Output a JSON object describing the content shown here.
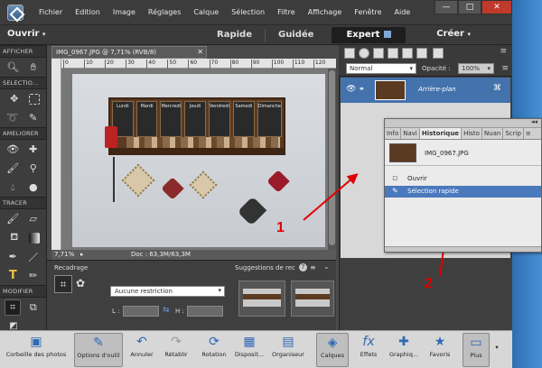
{
  "menubar": {
    "items": [
      "Fichier",
      "Edition",
      "Image",
      "Réglages",
      "Calque",
      "Sélection",
      "Filtre",
      "Affichage",
      "Fenêtre",
      "Aide"
    ],
    "minimize": "—",
    "maximize": "□",
    "close": "✕"
  },
  "modebar": {
    "open_label": "Ouvrir",
    "modes": [
      "Rapide",
      "Guidée",
      "Expert"
    ],
    "active_mode": "Expert",
    "create_label": "Créer"
  },
  "toolbox": {
    "sections": [
      "AFFICHER",
      "SELECTIO...",
      "AMELIORER",
      "TRACER",
      "MODIFIER"
    ]
  },
  "document": {
    "tab_title": "IMG_0967.JPG @ 7,71% (RVB/8)",
    "close": "✕",
    "zoom": "7,71%",
    "doc_info": "Doc : 63,3M/63,3M",
    "ruler_ticks": [
      "0",
      "10",
      "20",
      "30",
      "40",
      "50",
      "60",
      "70",
      "80",
      "90",
      "100",
      "110",
      "120"
    ],
    "photo_labels": [
      "Lundi",
      "Mardi",
      "Mercredi",
      "Jeudi",
      "Vendredi",
      "Samedi",
      "Dimanche"
    ]
  },
  "tool_options": {
    "tool_title": "Recadrage",
    "restriction": "Aucune restriction",
    "l_label": "L :",
    "h_label": "H :",
    "suggestions_label": "Suggestions de rec"
  },
  "layers": {
    "blend_mode": "Normal",
    "opacity_label": "Opacité :",
    "opacity_value": "100%",
    "layer_name": "Arrière-plan"
  },
  "history": {
    "tabs": [
      "Info",
      "Navi",
      "Historique",
      "Histo",
      "Nuan",
      "Scrip"
    ],
    "active_tab": "Historique",
    "snapshot_name": "IMG_0967.JPG",
    "items": [
      "Ouvrir",
      "Sélection rapide"
    ],
    "selected_item": "Sélection rapide"
  },
  "taskbar": {
    "buttons": [
      "Corbeille des photos",
      "Options d'outil",
      "Annuler",
      "Rétablir",
      "Rotation",
      "Disposit...",
      "Organiseur",
      "Calques",
      "Effets",
      "Graphiq...",
      "Favoris",
      "Plus"
    ]
  },
  "annotations": [
    "1",
    "2"
  ],
  "colors": {
    "accent": "#4a79bc",
    "annotation": "#e00000",
    "window_blue": "#3a78b5"
  }
}
